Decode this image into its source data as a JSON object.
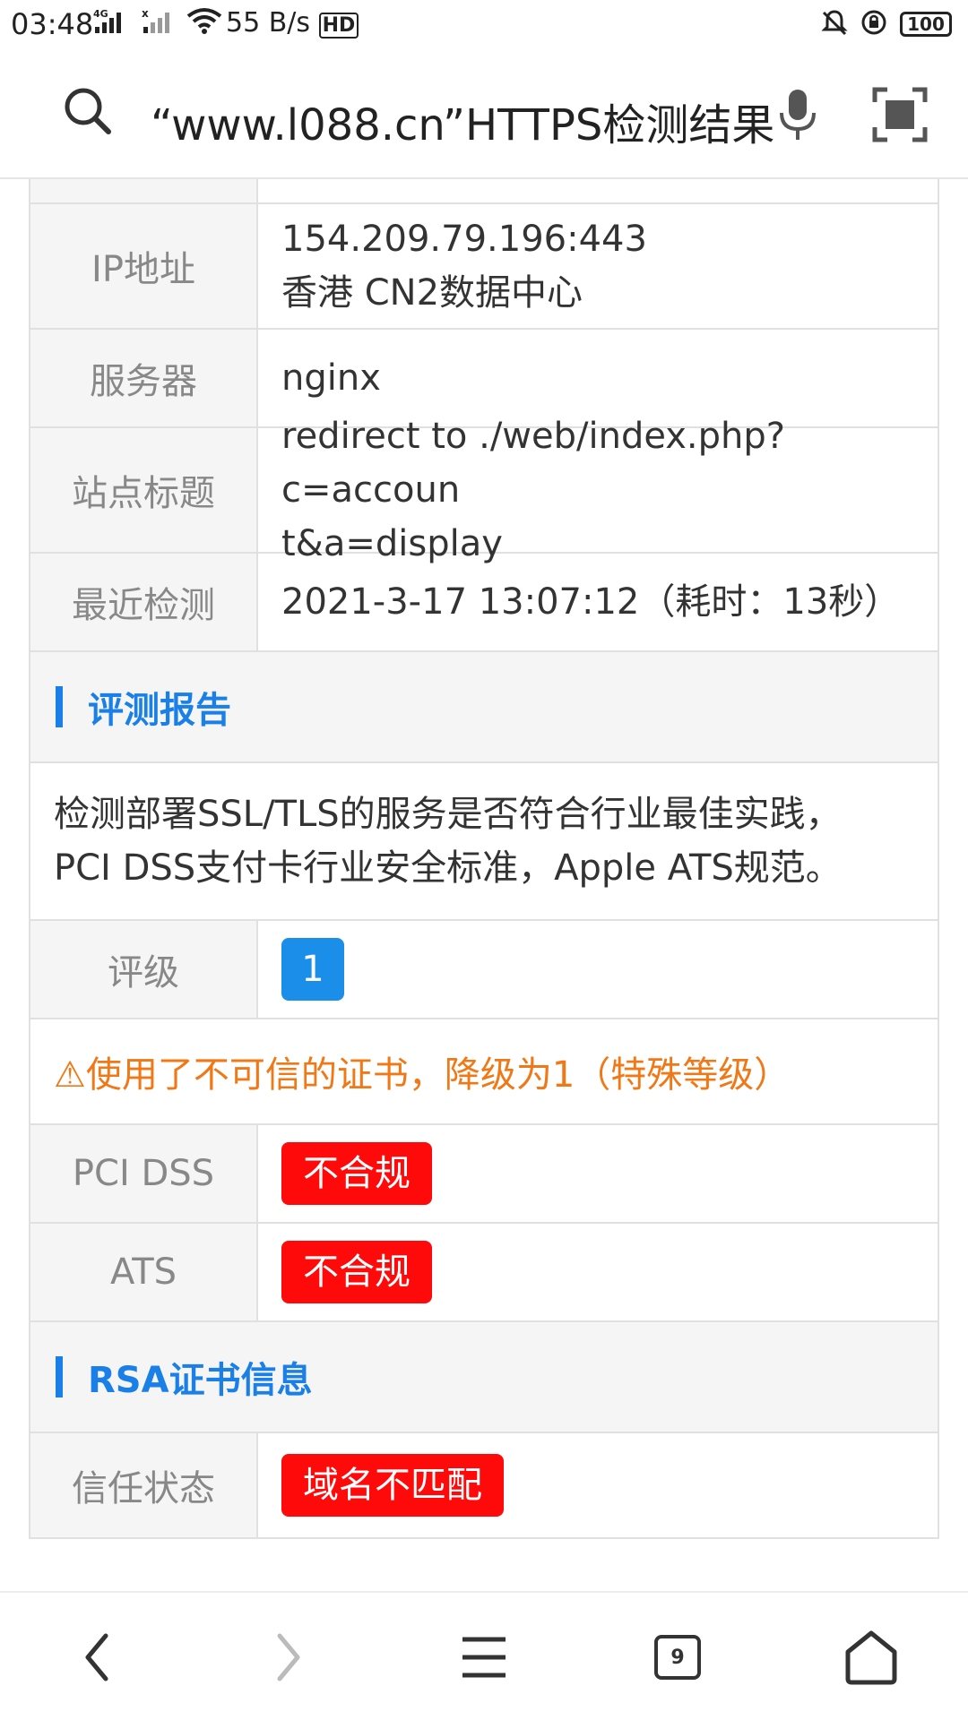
{
  "status_bar": {
    "time": "03:48",
    "network": "4G",
    "speed": "55 B/s",
    "hd_label": "HD",
    "battery": "100"
  },
  "search": {
    "query": "“www.l088.cn”HTTPS检测结果"
  },
  "info_rows": [
    {
      "label": "IP地址",
      "lines": [
        "154.209.79.196:443",
        "香港 CN2数据中心"
      ]
    },
    {
      "label": "服务器",
      "lines": [
        "nginx"
      ]
    },
    {
      "label": "站点标题",
      "lines": [
        "redirect to ./web/index.php?c=accoun",
        "t&a=display"
      ]
    },
    {
      "label": "最近检测",
      "lines": [
        "2021-3-17 13:07:12（耗时：13秒）"
      ]
    }
  ],
  "report": {
    "title": "评测报告",
    "description_lines": [
      "检测部署SSL/TLS的服务是否符合行业最佳实践，",
      "PCI DSS支付卡行业安全标准，Apple ATS规范。"
    ],
    "rating_label": "评级",
    "rating_value": "1",
    "warning": "⚠使用了不可信的证书，降级为1（特殊等级）",
    "pci_label": "PCI DSS",
    "pci_value": "不合规",
    "ats_label": "ATS",
    "ats_value": "不合规"
  },
  "rsa": {
    "title": "RSA证书信息",
    "trust_label": "信任状态",
    "trust_value": "域名不匹配"
  },
  "bottom_nav": {
    "tab_count": "9"
  },
  "colors": {
    "accent_blue": "#1a7fe6",
    "badge_red": "#ff0a0a",
    "warning_orange": "#f07816"
  }
}
